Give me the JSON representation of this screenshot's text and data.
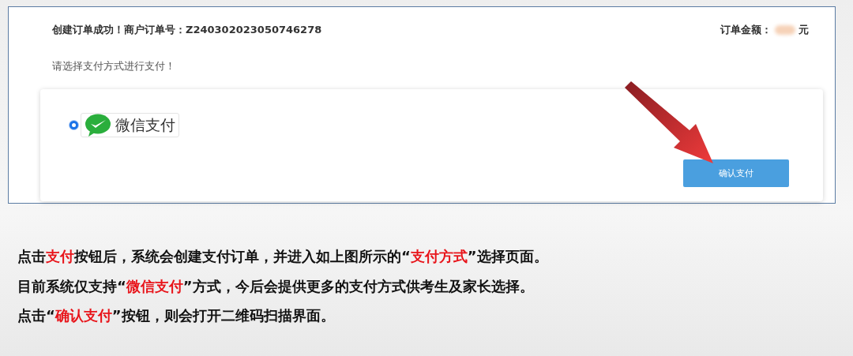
{
  "order_header": {
    "success_text": "创建订单成功！商户订单号：Z240302023050746278",
    "amount_label": "订单金额：",
    "amount_unit": "元"
  },
  "instruction": "请选择支付方式进行支付！",
  "payment_methods": [
    {
      "label": "微信支付",
      "selected": true
    }
  ],
  "confirm_button": "确认支付",
  "notes": [
    [
      {
        "text": "点击",
        "highlight": false
      },
      {
        "text": "支付",
        "highlight": true
      },
      {
        "text": "按钮后，系统会创建支付订单，并进入如上图所示的“",
        "highlight": false
      },
      {
        "text": "支付方式",
        "highlight": true
      },
      {
        "text": "”选择页面。",
        "highlight": false
      }
    ],
    [
      {
        "text": "目前系统仅支持“",
        "highlight": false
      },
      {
        "text": "微信支付",
        "highlight": true
      },
      {
        "text": "”方式，今后会提供更多的支付方式供考生及家长选择。",
        "highlight": false
      }
    ],
    [
      {
        "text": "点击“",
        "highlight": false
      },
      {
        "text": "确认支付",
        "highlight": true
      },
      {
        "text": "”按钮，则会打开二维码扫描界面。",
        "highlight": false
      }
    ]
  ]
}
